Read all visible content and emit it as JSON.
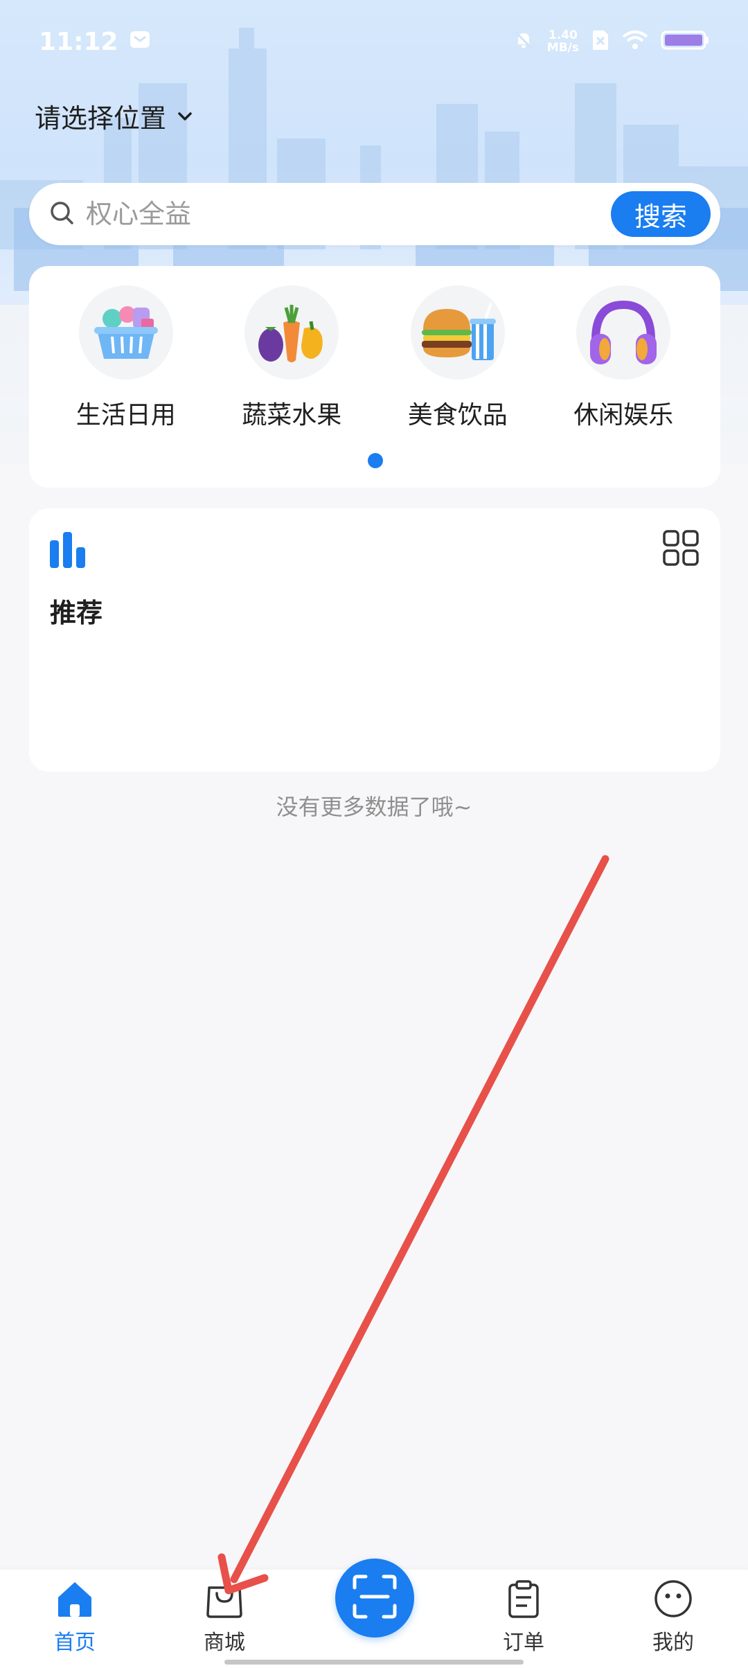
{
  "status_bar": {
    "time": "11:12",
    "net_speed_value": "1.40",
    "net_speed_unit": "MB/s",
    "icons": [
      "mail-icon",
      "mute-icon",
      "sim-icon",
      "wifi-icon",
      "battery-icon"
    ]
  },
  "header": {
    "location_label": "请选择位置"
  },
  "search": {
    "placeholder": "权心全益",
    "button_label": "搜索"
  },
  "categories": [
    {
      "label": "生活日用",
      "icon": "shopping-basket-icon"
    },
    {
      "label": "蔬菜水果",
      "icon": "vegetables-icon"
    },
    {
      "label": "美食饮品",
      "icon": "burger-drink-icon"
    },
    {
      "label": "休闲娱乐",
      "icon": "headphones-icon"
    }
  ],
  "recommend": {
    "title": "推荐"
  },
  "list_footer": {
    "text": "没有更多数据了哦~"
  },
  "bottom_nav": {
    "items": [
      {
        "label": "首页",
        "icon": "home-icon",
        "active": true
      },
      {
        "label": "商城",
        "icon": "shopping-bag-icon",
        "active": false
      },
      {
        "label": "订单",
        "icon": "clipboard-icon",
        "active": false
      },
      {
        "label": "我的",
        "icon": "face-icon",
        "active": false
      }
    ],
    "center_action": "scan-icon"
  },
  "colors": {
    "accent": "#1a7df0",
    "annotation": "#e8504a"
  }
}
